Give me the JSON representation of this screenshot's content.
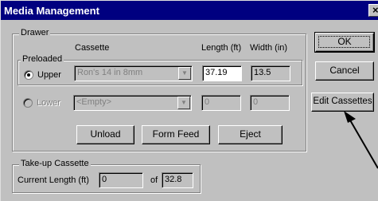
{
  "window": {
    "title": "Media Management",
    "close_glyph": "×"
  },
  "drawer": {
    "legend": "Drawer",
    "col_cassette": "Cassette",
    "col_length": "Length (ft)",
    "col_width": "Width (in)",
    "preloaded_legend": "Preloaded",
    "upper": {
      "label": "Upper",
      "cassette": "Ron's 14 in 8mm",
      "length": "37.19",
      "width": "13.5",
      "selected": true
    },
    "lower": {
      "label": "Lower",
      "cassette": "<Empty>",
      "length": "0",
      "width": "0",
      "selected": false
    },
    "buttons": {
      "unload": "Unload",
      "form_feed": "Form Feed",
      "eject": "Eject"
    }
  },
  "takeup": {
    "legend": "Take-up Cassette",
    "current_length_label": "Current Length (ft)",
    "current_length": "0",
    "of_label": "of",
    "total_length": "32.8"
  },
  "side_buttons": {
    "ok": "OK",
    "cancel": "Cancel",
    "edit_cassettes": "Edit Cassettes"
  },
  "annotation": {
    "arrow_color": "#000000"
  }
}
